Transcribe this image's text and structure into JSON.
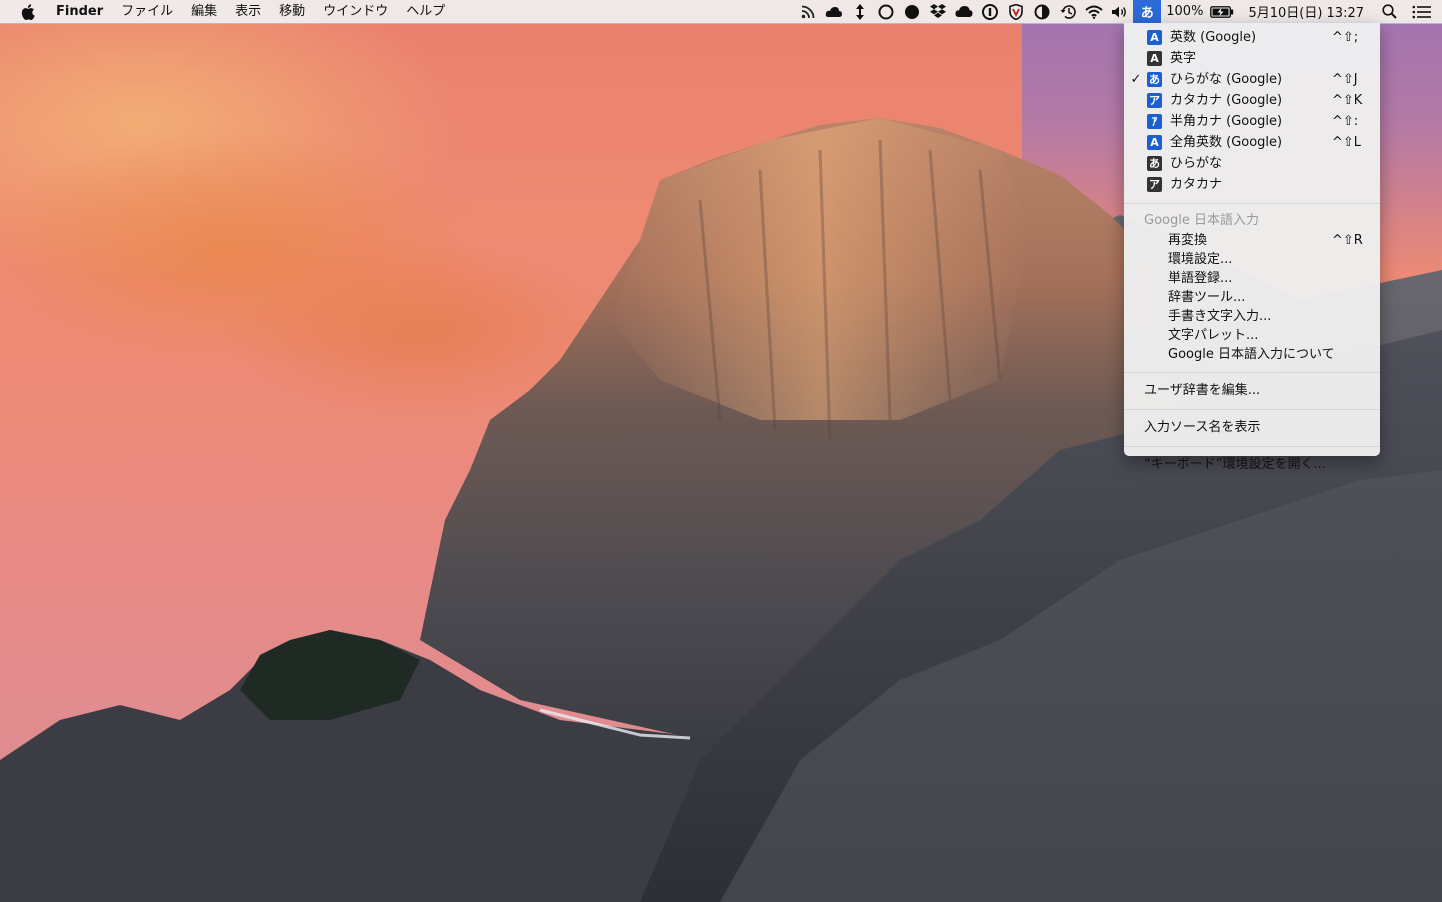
{
  "menubar": {
    "apple_icon": "apple-icon",
    "app_name": "Finder",
    "menus": [
      "ファイル",
      "編集",
      "表示",
      "移動",
      "ウインドウ",
      "ヘルプ"
    ],
    "status_icons": [
      "rss-icon",
      "cloud-icon",
      "arrows-icon",
      "circle-outline-icon",
      "circle-filled-icon",
      "dropbox-icon",
      "creative-cloud-icon",
      "1password-icon",
      "shield-icon",
      "half-circle-icon",
      "time-machine-icon",
      "wifi-icon",
      "volume-icon"
    ],
    "input_source": "あ",
    "battery_percent": "100%",
    "battery_icon": "battery-charging-icon",
    "datetime": "5月10日(日) 13:27",
    "search_icon": "spotlight-icon",
    "list_icon": "notification-center-icon"
  },
  "dropdown": {
    "input_sources": [
      {
        "icon": "A",
        "icon_style": "blue",
        "label": "英数 (Google)",
        "shortcut": "^⇧;",
        "checked": false
      },
      {
        "icon": "A",
        "icon_style": "dark",
        "label": "英字",
        "shortcut": "",
        "checked": false
      },
      {
        "icon": "あ",
        "icon_style": "blue",
        "label": "ひらがな (Google)",
        "shortcut": "^⇧J",
        "checked": true
      },
      {
        "icon": "ア",
        "icon_style": "blue",
        "label": "カタカナ (Google)",
        "shortcut": "^⇧K",
        "checked": false
      },
      {
        "icon": "ｱ",
        "icon_style": "blue",
        "label": "半角カナ (Google)",
        "shortcut": "^⇧:",
        "checked": false
      },
      {
        "icon": "A",
        "icon_style": "blue",
        "label": "全角英数 (Google)",
        "shortcut": "^⇧L",
        "checked": false
      },
      {
        "icon": "あ",
        "icon_style": "dark",
        "label": "ひらがな",
        "shortcut": "",
        "checked": false
      },
      {
        "icon": "ア",
        "icon_style": "dark",
        "label": "カタカナ",
        "shortcut": "",
        "checked": false
      }
    ],
    "check_mark": "✓",
    "google_header": "Google 日本語入力",
    "google_items": [
      {
        "label": "再変換",
        "shortcut": "^⇧R"
      },
      {
        "label": "環境設定...",
        "shortcut": ""
      },
      {
        "label": "単語登録...",
        "shortcut": ""
      },
      {
        "label": "辞書ツール...",
        "shortcut": ""
      },
      {
        "label": "手書き文字入力...",
        "shortcut": ""
      },
      {
        "label": "文字パレット...",
        "shortcut": ""
      },
      {
        "label": "Google 日本語入力について",
        "shortcut": ""
      }
    ],
    "edit_dictionary": "ユーザ辞書を編集...",
    "show_source_name": "入力ソース名を表示",
    "open_keyboard_prefs": "“キーボード”環境設定を開く..."
  },
  "colors": {
    "menu_highlight": "#2c6ad9",
    "sky_top": "#e97f6e",
    "sky_purple": "#a374b0"
  }
}
